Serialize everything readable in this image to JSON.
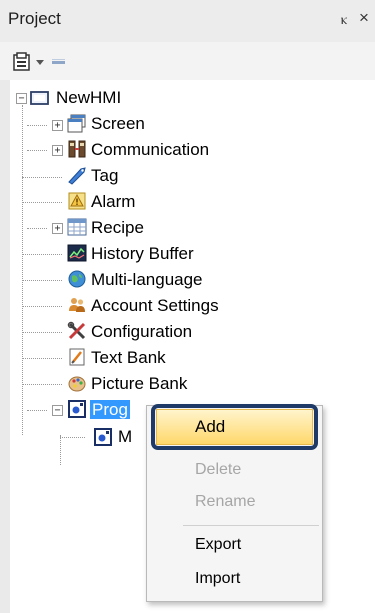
{
  "panel": {
    "title": "Project",
    "pin_glyph": "ⲕ",
    "close_glyph": "×"
  },
  "toolbar": {
    "icons": [
      "project-view-icon",
      "dropdown-arrow-icon",
      "collapse-icon"
    ]
  },
  "tree": {
    "root": {
      "label": "NewHMI",
      "icon": "hmi-monitor-icon",
      "expanded": true
    },
    "items": [
      {
        "label": "Screen",
        "icon": "screen-icon",
        "expandable": true
      },
      {
        "label": "Communication",
        "icon": "communication-icon",
        "expandable": true
      },
      {
        "label": "Tag",
        "icon": "tag-icon",
        "expandable": false
      },
      {
        "label": "Alarm",
        "icon": "alarm-icon",
        "expandable": false
      },
      {
        "label": "Recipe",
        "icon": "recipe-icon",
        "expandable": true
      },
      {
        "label": "History Buffer",
        "icon": "history-buffer-icon",
        "expandable": false
      },
      {
        "label": "Multi-language",
        "icon": "globe-icon",
        "expandable": false
      },
      {
        "label": "Account Settings",
        "icon": "account-users-icon",
        "expandable": false
      },
      {
        "label": "Configuration",
        "icon": "tools-icon",
        "expandable": false
      },
      {
        "label": "Text Bank",
        "icon": "text-bank-icon",
        "expandable": false
      },
      {
        "label": "Picture Bank",
        "icon": "picture-bank-icon",
        "expandable": false
      },
      {
        "label": "Prog",
        "icon": "program-icon",
        "expandable": true,
        "selected": true
      },
      {
        "label": "M",
        "icon": "program-child-icon",
        "expandable": false
      }
    ]
  },
  "context_menu": {
    "items": [
      {
        "label": "Add",
        "enabled": true,
        "highlighted": true
      },
      {
        "label": "Delete",
        "enabled": false
      },
      {
        "label": "Rename",
        "enabled": false
      },
      {
        "label": "Export",
        "enabled": true
      },
      {
        "label": "Import",
        "enabled": true
      }
    ]
  },
  "colors": {
    "selection": "#3399ff",
    "highlight_border": "#1f3a66",
    "menu_hover": "#ffd86b"
  }
}
